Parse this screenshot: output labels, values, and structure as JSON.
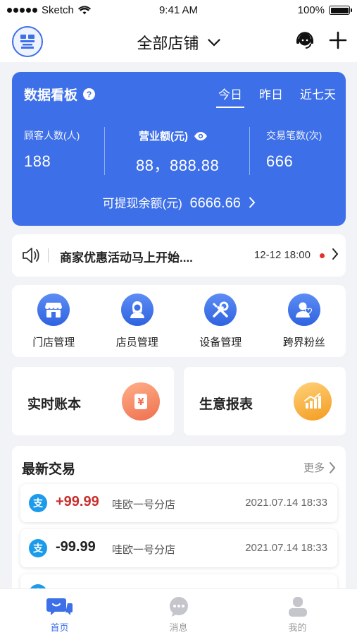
{
  "status_bar": {
    "carrier": "Sketch",
    "time": "9:41 AM",
    "battery": "100%"
  },
  "header": {
    "store_selector": "全部店铺",
    "icons": [
      "logo-icon",
      "headset-icon",
      "plus-icon"
    ]
  },
  "dashboard": {
    "title": "数据看板",
    "help_icon": "question-icon",
    "tabs": [
      {
        "label": "今日",
        "active": true
      },
      {
        "label": "昨日",
        "active": false
      },
      {
        "label": "近七天",
        "active": false
      }
    ],
    "metrics": [
      {
        "label": "顾客人数(人)",
        "value": "188"
      },
      {
        "label": "营业额(元)",
        "value": "88，888.88",
        "icon": "eye-icon"
      },
      {
        "label": "交易笔数(次)",
        "value": "666"
      }
    ],
    "withdraw": {
      "label": "可提现余额(元)",
      "amount": "6666.66"
    },
    "color": "#3d6fe8"
  },
  "notice": {
    "text": "商家优惠活动马上开始....",
    "date": "12-12 18:00",
    "unread_color": "#e5302f"
  },
  "menu": [
    {
      "label": "门店管理",
      "icon": "store-icon"
    },
    {
      "label": "店员管理",
      "icon": "staff-icon"
    },
    {
      "label": "设备管理",
      "icon": "tools-icon"
    },
    {
      "label": "跨界粉丝",
      "icon": "fans-icon"
    }
  ],
  "cards": [
    {
      "label": "实时账本",
      "icon": "ledger-icon",
      "color": "#f4845f"
    },
    {
      "label": "生意报表",
      "icon": "chart-icon",
      "color": "#f6a623"
    }
  ],
  "transactions": {
    "title": "最新交易",
    "more": "更多",
    "rows": [
      {
        "amount": "+99.99",
        "store": "哇欧一号分店",
        "time": "2021.07.14 18:33",
        "color": "#c8302e",
        "pay_icon": "alipay-icon"
      },
      {
        "amount": "-99.99",
        "store": "哇欧一号分店",
        "time": "2021.07.14 18:33",
        "color": "#222222",
        "pay_icon": "alipay-icon"
      }
    ]
  },
  "tabbar": [
    {
      "label": "首页",
      "icon": "home-chat-icon",
      "active": true
    },
    {
      "label": "消息",
      "icon": "message-icon",
      "active": false
    },
    {
      "label": "我的",
      "icon": "user-icon",
      "active": false
    }
  ]
}
